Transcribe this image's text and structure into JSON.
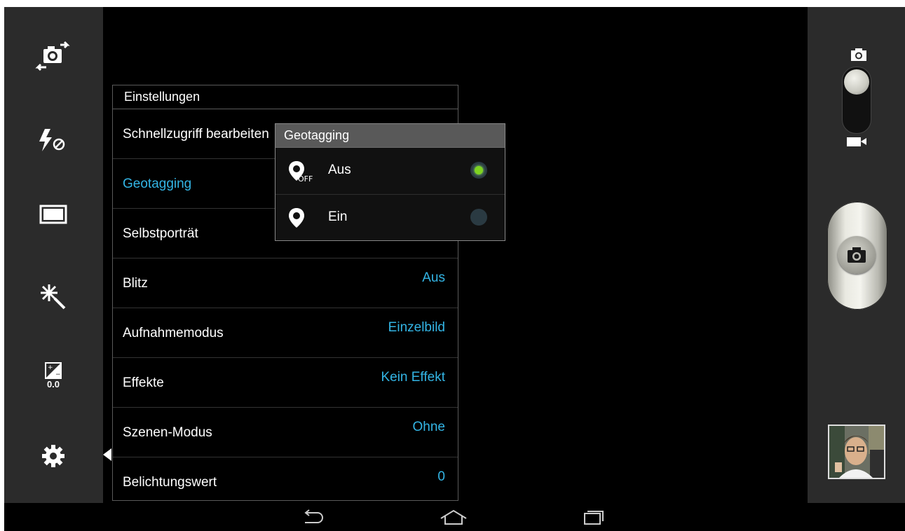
{
  "left_toolbar": {
    "items": [
      {
        "name": "switch-camera"
      },
      {
        "name": "flash-off"
      },
      {
        "name": "aspect-ratio"
      },
      {
        "name": "effects"
      },
      {
        "name": "exposure",
        "label": "0.0"
      },
      {
        "name": "settings"
      }
    ]
  },
  "settings": {
    "title": "Einstellungen",
    "rows": [
      {
        "label": "Schnellzugriff bearbeiten",
        "value": ""
      },
      {
        "label": "Geotagging",
        "value": ""
      },
      {
        "label": "Selbstporträt",
        "value": ""
      },
      {
        "label": "Blitz",
        "value": "Aus"
      },
      {
        "label": "Aufnahmemodus",
        "value": "Einzelbild"
      },
      {
        "label": "Effekte",
        "value": "Kein Effekt"
      },
      {
        "label": "Szenen-Modus",
        "value": "Ohne"
      },
      {
        "label": "Belichtungswert",
        "value": "0"
      }
    ]
  },
  "popup": {
    "title": "Geotagging",
    "options": [
      {
        "label": "Aus",
        "icon_badge": "OFF",
        "selected": true
      },
      {
        "label": "Ein",
        "selected": false
      }
    ],
    "selected_color": "#7ed321"
  },
  "colors": {
    "accent": "#33b5e5",
    "sidebar_bg": "#2b2b2b"
  }
}
